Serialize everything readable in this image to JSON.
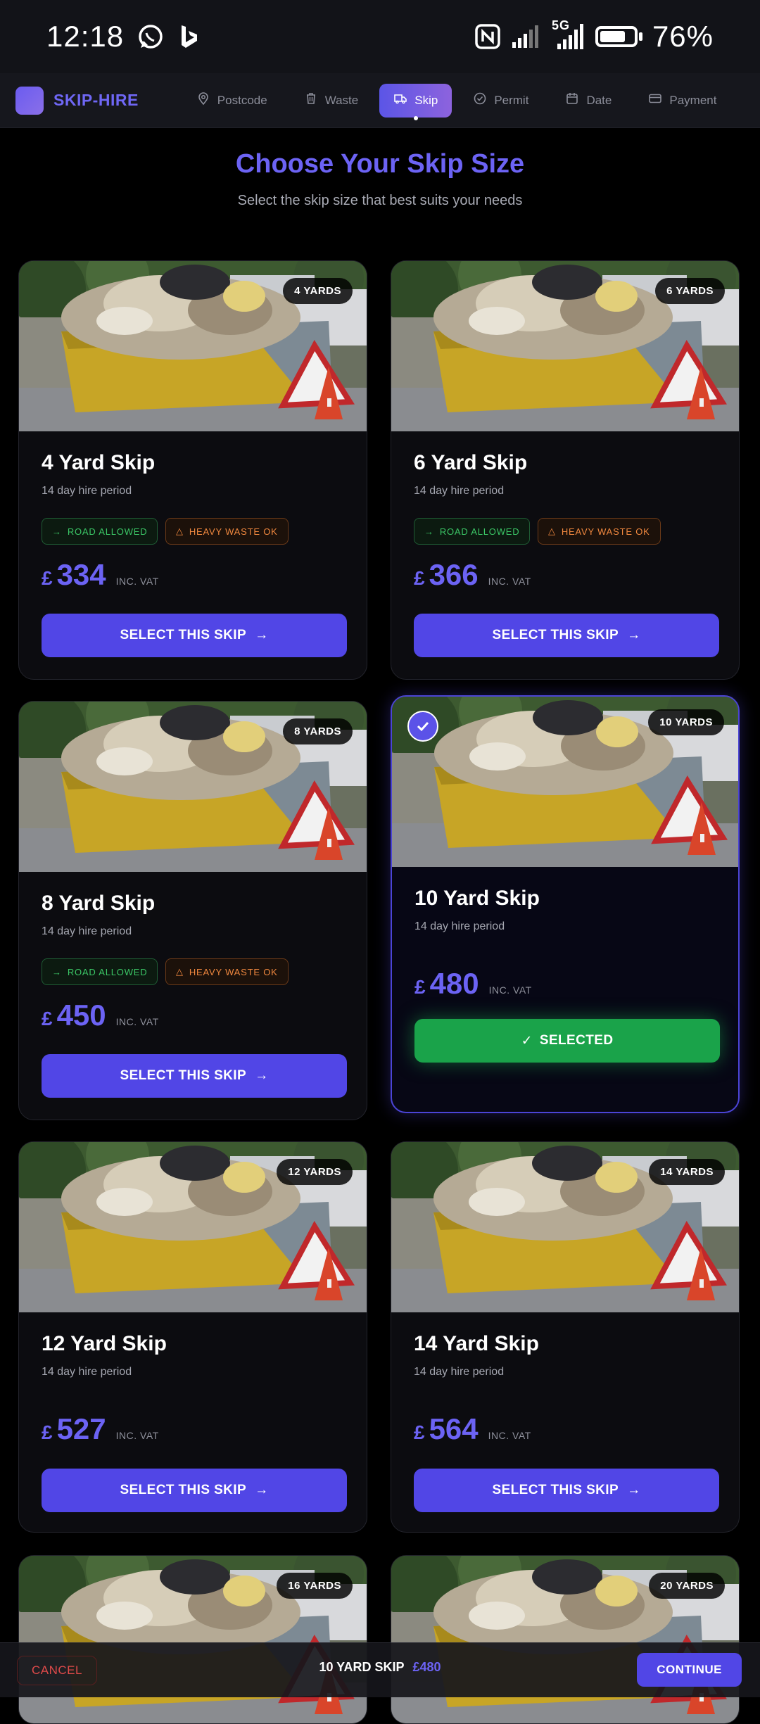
{
  "status_bar": {
    "time": "12:18",
    "network": "5G",
    "battery": "76%",
    "battery_level": 0.76
  },
  "brand": {
    "name": "SKIP-HIRE"
  },
  "nav_steps": [
    {
      "label": "Postcode",
      "icon": "map-pin-icon",
      "active": false
    },
    {
      "label": "Waste",
      "icon": "trash-icon",
      "active": false
    },
    {
      "label": "Skip",
      "icon": "truck-icon",
      "active": true
    },
    {
      "label": "Permit",
      "icon": "check-circle-icon",
      "active": false
    },
    {
      "label": "Date",
      "icon": "calendar-icon",
      "active": false
    },
    {
      "label": "Payment",
      "icon": "credit-card-icon",
      "active": false
    }
  ],
  "heading": {
    "title": "Choose Your Skip Size",
    "subtitle": "Select the skip size that best suits your needs"
  },
  "cards": [
    {
      "badge": "4 YARDS",
      "title": "4 Yard Skip",
      "period": "14 day hire period",
      "road": "ROAD ALLOWED",
      "heavy": "HEAVY WASTE OK",
      "currency": "£",
      "price": "334",
      "vat": "INC. VAT",
      "button": "SELECT THIS SKIP"
    },
    {
      "badge": "6 YARDS",
      "title": "6 Yard Skip",
      "period": "14 day hire period",
      "road": "ROAD ALLOWED",
      "heavy": "HEAVY WASTE OK",
      "currency": "£",
      "price": "366",
      "vat": "INC. VAT",
      "button": "SELECT THIS SKIP"
    },
    {
      "badge": "8 YARDS",
      "title": "8 Yard Skip",
      "period": "14 day hire period",
      "road": "ROAD ALLOWED",
      "heavy": "HEAVY WASTE OK",
      "currency": "£",
      "price": "450",
      "vat": "INC. VAT",
      "button": "SELECT THIS SKIP"
    },
    {
      "badge": "10 YARDS",
      "title": "10 Yard Skip",
      "period": "14 day hire period",
      "currency": "£",
      "price": "480",
      "vat": "INC. VAT",
      "button": "SELECTED",
      "selected": true
    },
    {
      "badge": "12 YARDS",
      "title": "12 Yard Skip",
      "period": "14 day hire period",
      "currency": "£",
      "price": "527",
      "vat": "INC. VAT",
      "button": "SELECT THIS SKIP"
    },
    {
      "badge": "14 YARDS",
      "title": "14 Yard Skip",
      "period": "14 day hire period",
      "currency": "£",
      "price": "564",
      "vat": "INC. VAT",
      "button": "SELECT THIS SKIP"
    },
    {
      "badge": "16 YARDS"
    },
    {
      "badge": "20 YARDS"
    }
  ],
  "bottom_bar": {
    "cancel": "CANCEL",
    "summary_label": "10 YARD SKIP",
    "summary_price": "£480",
    "continue": "CONTINUE"
  },
  "colors": {
    "accent": "#5146e6",
    "title_purple": "#6c63f4",
    "selected_green": "#1aa34a",
    "road_green": "#3bc766",
    "heavy_orange": "#f0883f",
    "cancel_red": "#e04a4a"
  }
}
